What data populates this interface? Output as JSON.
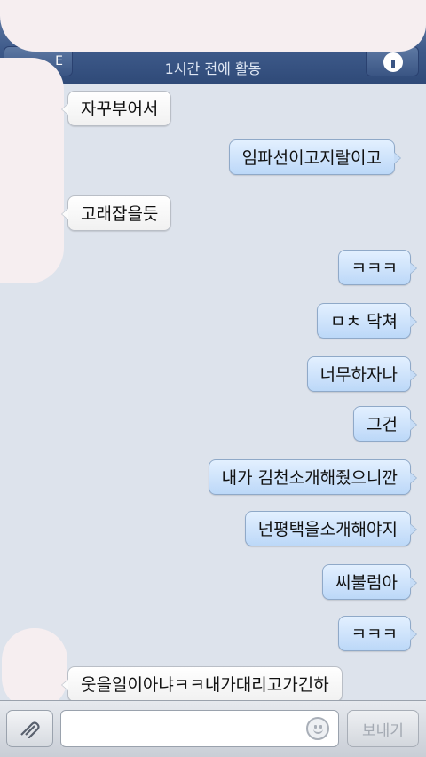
{
  "header": {
    "back_label": "E",
    "status": "1시간 전에 활동",
    "info_icon": "info-icon"
  },
  "messages": [
    {
      "side": "in",
      "text": "자꾸부어서"
    },
    {
      "side": "out",
      "text": "임파선이고지랄이고"
    },
    {
      "side": "in",
      "text": "고래잡을듯"
    },
    {
      "side": "out",
      "text": "ㅋㅋㅋ"
    },
    {
      "side": "out",
      "text": "ㅁㅊ 닥쳐"
    },
    {
      "side": "out",
      "text": "너무하자나"
    },
    {
      "side": "out",
      "text": "그건"
    },
    {
      "side": "out",
      "text": "내가 김천소개해줬으니깐"
    },
    {
      "side": "out",
      "text": "넌평택을소개해야지"
    },
    {
      "side": "out",
      "text": "씨불럼아"
    },
    {
      "side": "out",
      "text": "ㅋㅋㅋ"
    },
    {
      "side": "in",
      "text": "웃을일이아냐ㅋㅋ내가대리고가긴하"
    }
  ],
  "input_bar": {
    "attach_icon": "paperclip-icon",
    "message_value": "",
    "emoji_icon": "smiley-icon",
    "send_label": "보내기"
  },
  "colors": {
    "header": "#3e5a8a",
    "background": "#dde3ec",
    "incoming_bubble": "#ffffff",
    "outgoing_bubble": "#c6dcf6"
  }
}
